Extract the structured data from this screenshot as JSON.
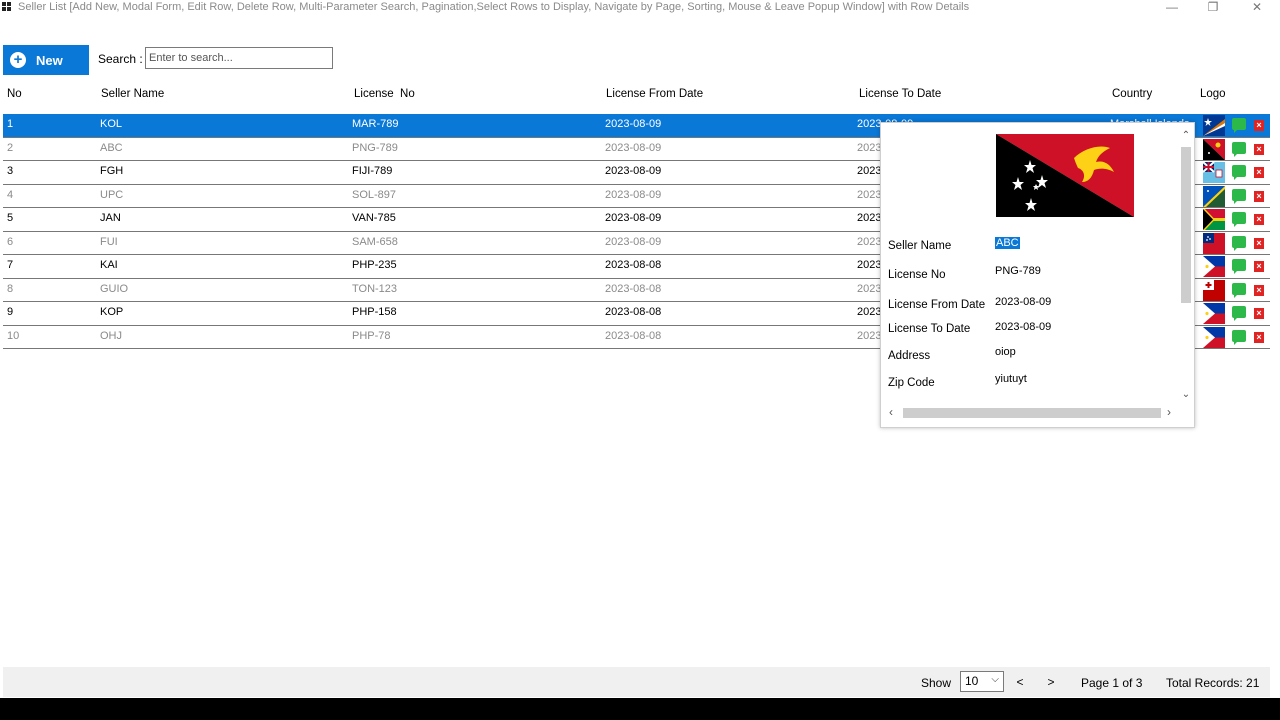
{
  "window": {
    "title": "Seller List [Add New, Modal Form, Edit Row, Delete Row, Multi-Parameter Search, Pagination,Select Rows to Display, Navigate by Page, Sorting, Mouse & Leave Popup Window] with Row Details",
    "minimize": "—",
    "maximize": "❐",
    "close": "✕"
  },
  "toolbar": {
    "new_label": "New",
    "new_icon": "plus-circle-icon",
    "search_label": "Search :",
    "search_placeholder": "Enter to search..."
  },
  "columns": [
    "No",
    "Seller Name",
    "License  No",
    "License From Date",
    "License To Date",
    "Country",
    "Logo"
  ],
  "rows": [
    {
      "no": "1",
      "seller": "KOL",
      "license": "MAR-789",
      "from": "2023-08-09",
      "to": "2023-08-09",
      "country": "Marshall Islands",
      "flag": "marshall-islands-flag"
    },
    {
      "no": "2",
      "seller": "ABC",
      "license": "PNG-789",
      "from": "2023-08-09",
      "to": "2023",
      "country": "",
      "flag": "papua-new-guinea-flag"
    },
    {
      "no": "3",
      "seller": "FGH",
      "license": "FIJI-789",
      "from": "2023-08-09",
      "to": "2023",
      "country": "",
      "flag": "fiji-flag"
    },
    {
      "no": "4",
      "seller": "UPC",
      "license": "SOL-897",
      "from": "2023-08-09",
      "to": "2023",
      "country": "",
      "flag": "solomon-islands-flag"
    },
    {
      "no": "5",
      "seller": "JAN",
      "license": "VAN-785",
      "from": "2023-08-09",
      "to": "2023",
      "country": "",
      "flag": "vanuatu-flag"
    },
    {
      "no": "6",
      "seller": "FUI",
      "license": "SAM-658",
      "from": "2023-08-09",
      "to": "2023",
      "country": "",
      "flag": "samoa-flag"
    },
    {
      "no": "7",
      "seller": "KAI",
      "license": "PHP-235",
      "from": "2023-08-08",
      "to": "2023",
      "country": "",
      "flag": "philippines-flag"
    },
    {
      "no": "8",
      "seller": "GUIO",
      "license": "TON-123",
      "from": "2023-08-08",
      "to": "2023",
      "country": "",
      "flag": "tonga-flag"
    },
    {
      "no": "9",
      "seller": "KOP",
      "license": "PHP-158",
      "from": "2023-08-08",
      "to": "2023",
      "country": "",
      "flag": "philippines-flag"
    },
    {
      "no": "10",
      "seller": "OHJ",
      "license": "PHP-78",
      "from": "2023-08-08",
      "to": "2023",
      "country": "",
      "flag": "philippines-flag"
    }
  ],
  "popup": {
    "flag": "papua-new-guinea-flag",
    "fields": [
      {
        "label": "Seller Name",
        "value": "ABC"
      },
      {
        "label": "License No",
        "value": "PNG-789"
      },
      {
        "label": "License From Date",
        "value": "2023-08-09"
      },
      {
        "label": "License To Date",
        "value": "2023-08-09"
      },
      {
        "label": "Address",
        "value": "oiop"
      },
      {
        "label": "Zip Code",
        "value": "yiutuyt"
      }
    ]
  },
  "footer": {
    "show_label": "Show",
    "show_value": "10",
    "prev": "<",
    "next": ">",
    "page_text": "Page 1 of 3",
    "total_text": "Total Records: 21"
  },
  "colors": {
    "accent": "#0a78d7",
    "edit": "#2db84a",
    "delete": "#e02424"
  }
}
